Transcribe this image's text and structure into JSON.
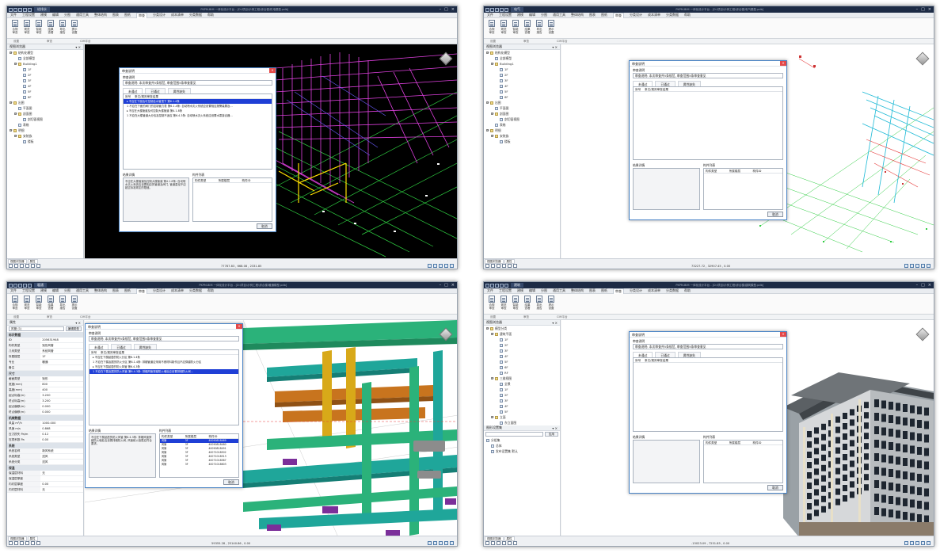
{
  "menu_items": [
    "文件",
    "工程设置",
    "建模",
    "编辑",
    "分图",
    "通用工具",
    "整体结构",
    "图表",
    "图纸",
    "审查",
    "分类设计",
    "成本清单",
    "分类数据",
    "帮助"
  ],
  "active_menu": "审查",
  "ribbon_buttons": [
    {
      "label1": "合规",
      "label2": "审查"
    },
    {
      "label1": "规范",
      "label2": "审查"
    },
    {
      "label1": "智能",
      "label2": "审查"
    },
    {
      "label1": "结果",
      "label2": "查看"
    },
    {
      "label1": "导出",
      "label2": "报告"
    },
    {
      "label1": "提示",
      "label2": "设置"
    }
  ],
  "ribbon_groups": [
    "设置",
    "审查",
    "CIM平台"
  ],
  "browser_title": "视图浏览器",
  "properties_title": "属性",
  "tree_nodes": [
    {
      "depth": 0,
      "toggle": "⊟",
      "text": "结构化模型",
      "folder": true
    },
    {
      "depth": 1,
      "toggle": "",
      "text": "全部模型",
      "folder": false
    },
    {
      "depth": 1,
      "toggle": "⊟",
      "text": "Building1",
      "folder": true
    },
    {
      "depth": 2,
      "toggle": "",
      "text": "1F",
      "folder": false
    },
    {
      "depth": 2,
      "toggle": "",
      "text": "2F",
      "folder": false
    },
    {
      "depth": 2,
      "toggle": "",
      "text": "3F",
      "folder": false
    },
    {
      "depth": 2,
      "toggle": "",
      "text": "4F",
      "folder": false
    },
    {
      "depth": 2,
      "toggle": "",
      "text": "5F",
      "folder": false
    },
    {
      "depth": 2,
      "toggle": "",
      "text": "6F",
      "folder": false
    },
    {
      "depth": 0,
      "toggle": "⊟",
      "text": "出图",
      "folder": true
    },
    {
      "depth": 1,
      "toggle": "",
      "text": "平面图",
      "folder": false
    },
    {
      "depth": 1,
      "toggle": "⊟",
      "text": "剖面图",
      "folder": true
    },
    {
      "depth": 2,
      "toggle": "",
      "text": "剖切面视图",
      "folder": false
    },
    {
      "depth": 1,
      "toggle": "",
      "text": "表格",
      "folder": false
    },
    {
      "depth": 0,
      "toggle": "⊟",
      "text": "明细",
      "folder": true
    },
    {
      "depth": 1,
      "toggle": "⊟",
      "text": "安装族",
      "folder": true
    },
    {
      "depth": 2,
      "toggle": "",
      "text": "楼板",
      "folder": false
    }
  ],
  "tree4": {
    "title": "视图浏览器",
    "nodes": [
      {
        "depth": 0,
        "toggle": "⊟",
        "text": "模型分类",
        "folder": true
      },
      {
        "depth": 1,
        "toggle": "⊟",
        "text": "建筑平面",
        "folder": true
      },
      {
        "depth": 2,
        "toggle": "",
        "text": "1F",
        "folder": false
      },
      {
        "depth": 2,
        "toggle": "",
        "text": "2F",
        "folder": false
      },
      {
        "depth": 2,
        "toggle": "",
        "text": "3F",
        "folder": false
      },
      {
        "depth": 2,
        "toggle": "",
        "text": "4F",
        "folder": false
      },
      {
        "depth": 2,
        "toggle": "",
        "text": "5F",
        "folder": false
      },
      {
        "depth": 2,
        "toggle": "",
        "text": "6F",
        "folder": false
      },
      {
        "depth": 2,
        "toggle": "",
        "text": "RF",
        "folder": false
      },
      {
        "depth": 1,
        "toggle": "⊟",
        "text": "三维视图",
        "folder": true
      },
      {
        "depth": 2,
        "toggle": "",
        "text": "全景",
        "folder": false
      },
      {
        "depth": 2,
        "toggle": "",
        "text": "1F",
        "folder": false
      },
      {
        "depth": 2,
        "toggle": "",
        "text": "2F",
        "folder": false
      },
      {
        "depth": 2,
        "toggle": "",
        "text": "3F",
        "folder": false
      },
      {
        "depth": 2,
        "toggle": "",
        "text": "4F",
        "folder": false
      },
      {
        "depth": 2,
        "toggle": "",
        "text": "5F",
        "folder": false
      },
      {
        "depth": 1,
        "toggle": "⊟",
        "text": "立面",
        "folder": true
      },
      {
        "depth": 2,
        "toggle": "",
        "text": "东立面图",
        "folder": false
      }
    ],
    "lower_title": "图形设置集",
    "search_btn": "应用",
    "lower_nodes": [
      {
        "text": "分组集"
      },
      {
        "text": "总体"
      },
      {
        "text": "发布设置集 默认"
      }
    ]
  },
  "props": {
    "type_select": "风管 (1)",
    "edit_type": "编辑类型",
    "sections": [
      {
        "title": "标识数据",
        "rows": [
          [
            "ID",
            "205631948"
          ],
          [
            "构件类型",
            "矩形风管"
          ],
          [
            "几何类型",
            "系统风管"
          ],
          [
            "所属楼层",
            "1F"
          ],
          [
            "专业",
            "暖通"
          ],
          [
            "备注",
            ""
          ]
        ]
      },
      {
        "title": "尺寸",
        "rows": [
          [
            "截面类型",
            "矩形"
          ],
          [
            "宽度(mm)",
            "800"
          ],
          [
            "高度(mm)",
            "400"
          ],
          [
            "起点标高(m)",
            "3.200"
          ],
          [
            "终点标高(m)",
            "3.200"
          ],
          [
            "起点偏移(m)",
            "0.000"
          ],
          [
            "终点偏移(m)",
            "0.000"
          ]
        ]
      },
      {
        "title": "机械数据",
        "rows": [
          [
            "风量 m³/h",
            "1000.000"
          ],
          [
            "风速 m/s",
            "0.868"
          ],
          [
            "压力损失 Pa/m",
            "0.12"
          ],
          [
            "压损系数 Pa",
            "0.00"
          ]
        ]
      },
      {
        "title": "系统",
        "rows": [
          [
            "系统名称",
            "新风系统"
          ],
          [
            "系统类型",
            "送风"
          ],
          [
            "系统分类",
            "送风"
          ]
        ]
      },
      {
        "title": "保温",
        "rows": [
          [
            "保温层材料",
            "无"
          ],
          [
            "保温层厚度",
            ""
          ],
          [
            "内衬层厚度",
            "0.00"
          ],
          [
            "内衬层材料",
            "无"
          ]
        ]
      }
    ]
  },
  "windows": [
    {
      "doc_tab": "给排水",
      "title": "PKPM-BIM 一体化设计平台 - [D:\\项目\\示例工程\\综合楼\\机电模型.pdb]",
      "coords": "77787.83 , 668.08 , 2331.85",
      "dialog": {
        "title": "审查说明",
        "rule_label": "审查说明",
        "rule_text": "审查说明: 本次审查共5条规范, 审查范围5条审查意见",
        "tabs": [
          "未通过",
          "已通过",
          "属性缺失"
        ],
        "active_tab": "未通过",
        "col_no": "序号",
        "col_content": "条文/规则审查结果",
        "rows": [
          {
            "text": "▸ 不应在下面及可控制给水管顶下 第6.1.4条",
            "sel": true
          },
          {
            "text": "1  不应在下面的阀门的控制管力表 第6.1.4条: 自动喷水灭火系统应设置相应报警装置及...",
            "sel": false
          },
          {
            "text": "▸ 不应在大楼管道及可控制大楼管道 第4.1.8条",
            "sel": false
          },
          {
            "text": "1  不应在大楼管道大分包及控制不适应 第6.4.3条: 自动喷水灭火系统应设置水泵接合器...",
            "sel": false
          }
        ],
        "detail_label": "结果详情",
        "detail_text": "不应在大楼管道及控制大楼管道 第4.1.8条: 自动喷水灭火系统应设置相应的管道及阀门, 管道直径不应超过标准规定的限值。",
        "parts_label": "构件列表",
        "parts_cols": [
          "构件类型",
          "所属楼层",
          "构件ID"
        ],
        "parts_rows": [],
        "btn": "取消"
      }
    },
    {
      "doc_tab": "电气",
      "title": "PKPM-BIM 一体化设计平台 - [D:\\项目\\示例工程\\综合楼\\电气模型.pdb]",
      "coords": "73227.72 , 32907.45 , 0.00",
      "dialog": {
        "title": "审查说明",
        "rule_label": "审查说明",
        "rule_text": "审查说明: 本次审查共5条规范, 审查范围5条审查意见",
        "tabs": [
          "未通过",
          "已通过",
          "属性缺失"
        ],
        "active_tab": "未通过",
        "col_no": "序号",
        "col_content": "条文/规则审查结果",
        "rows": [],
        "detail_label": "结果详情",
        "detail_text": "",
        "parts_label": "构件列表",
        "parts_cols": [
          "构件类型",
          "所属楼层",
          "构件ID"
        ],
        "parts_rows": [],
        "btn": "取消"
      }
    },
    {
      "doc_tab": "暖通",
      "title": "PKPM-BIM 一体化设计平台 - [D:\\项目\\示例工程\\综合楼\\暖通模型.pdb]",
      "coords": "59355.28 , 25140.86 , 0.00",
      "dialog": {
        "title": "审查说明",
        "rule_label": "审查说明",
        "rule_text": "审查说明: 本次审查共5条规范, 审查范围5条审查意见",
        "tabs": [
          "未通过",
          "已通过",
          "属性缺失"
        ],
        "active_tab": "未通过",
        "col_no": "序号",
        "col_content": "条文/规则审查结果",
        "rows": [
          {
            "text": "▸ 不应在下属起居的防火分区 第6.1.4条",
            "sel": false
          },
          {
            "text": "1  不应在下属起居的防火分区 第6.1.4条: 排烟管道应采用不燃材料制作且不应穿越防火分区",
            "sel": false
          },
          {
            "text": "▸ 不应在下属起居的防火风管 第6.4.3条",
            "sel": false
          },
          {
            "text": "1  不应在下属起居的防火风管 第6.4.3条: 排烟风管穿越防火墙处应设置排烟防火阀...",
            "sel": true
          }
        ],
        "detail_label": "结果详情",
        "detail_text": "不应在下属起居的防火风管 第6.4.3条: 排烟风管穿越防火墙处应设置排烟防火阀, 风管耐火极限应符合要求。",
        "parts_label": "构件列表",
        "parts_cols": [
          "构件类型",
          "所属楼层",
          "构件ID"
        ],
        "parts_rows": [
          {
            "cells": [
              "风管",
              "3F",
              "40090818469"
            ],
            "sel": true
          },
          {
            "cells": [
              "风管",
              "3F",
              "40090818480"
            ],
            "sel": false
          },
          {
            "cells": [
              "风管",
              "3F",
              "40090818491"
            ],
            "sel": false
          },
          {
            "cells": [
              "风管",
              "3F",
              "40071018502"
            ],
            "sel": false
          },
          {
            "cells": [
              "风管",
              "3F",
              "40071018513"
            ],
            "sel": false
          },
          {
            "cells": [
              "风管",
              "3F",
              "40071018587"
            ],
            "sel": false
          },
          {
            "cells": [
              "风管",
              "3F",
              "40071018603"
            ],
            "sel": false
          }
        ],
        "btn": "取消"
      }
    },
    {
      "doc_tab": "建筑",
      "title": "PKPM-BIM 一体化设计平台 - [D:\\项目\\示例工程\\综合楼\\建筑模型.pdb]",
      "coords": "-15023.09 , 7251.85 , 0.00",
      "dialog": {
        "title": "审查说明",
        "rule_label": "审查说明",
        "rule_text": "审查说明: 本次审查共5条规范, 审查范围5条审查意见",
        "tabs": [
          "未通过",
          "已通过",
          "属性缺失"
        ],
        "active_tab": "未通过",
        "col_no": "序号",
        "col_content": "条文/规则审查结果",
        "rows": [],
        "detail_label": "结果详情",
        "detail_text": "",
        "parts_label": "构件列表",
        "parts_cols": [
          "构件类型",
          "所属楼层",
          "构件ID"
        ],
        "parts_rows": [],
        "btn": "取消"
      }
    }
  ],
  "bottom_tabs": [
    "视图浏览器",
    "属性"
  ],
  "colors": {
    "dark_bg": "#000000",
    "magenta": "#e040e0",
    "green": "#2ecc40",
    "yellow": "#ffe000",
    "teal": "#1fa69a",
    "orange": "#c8741e",
    "select_blue": "#1f3fd6"
  }
}
